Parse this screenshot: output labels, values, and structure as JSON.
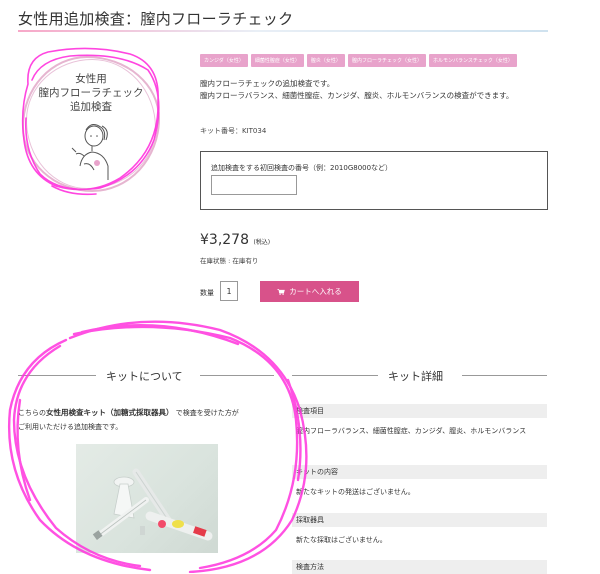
{
  "page": {
    "title": "女性用追加検査：膣内フローラチェック"
  },
  "product_image": {
    "lines": [
      "女性用",
      "膣内フローラチェック",
      "追加検査"
    ]
  },
  "tags": [
    "カンジダ（女性）",
    "細菌性膣症（女性）",
    "膣炎（女性）",
    "膣内フローラチェック（女性）",
    "ホルモンバランスチェック（女性）"
  ],
  "description": {
    "line1": "膣内フローラチェックの追加検査です。",
    "line2": "膣内フローラバランス、細菌性膣症、カンジダ、膣炎、ホルモンバランスの検査ができます。"
  },
  "kit_number": "キット番号：KIT034",
  "initial_test": {
    "label": "追加検査をする初回検査の番号（例：2010G8000など）",
    "value": ""
  },
  "price": {
    "amount": "¥3,278",
    "tax": "(税込)"
  },
  "stock": "在庫状態 : 在庫有り",
  "quantity": {
    "label": "数量",
    "value": "1"
  },
  "cart_button": "カートへ入れる",
  "kit_about": {
    "heading": "キットについて",
    "text_pre": "こちらの",
    "text_bold": "女性用検査キット（加糖式採取器具）",
    "text_post": "で検査を受けた方が",
    "text_line2": "ご利用いただける追加検査です。"
  },
  "kit_details": {
    "heading": "キット詳細",
    "rows": [
      {
        "label": "検査項目",
        "value": "膣内フローラバランス、細菌性膣症、カンジダ、膣炎、ホルモンバランス"
      },
      {
        "label": "キットの内容",
        "value": "新たなキットの発送はございません。"
      },
      {
        "label": "採取器具",
        "value": "新たな採取はございません。"
      },
      {
        "label": "検査方法",
        "value": ""
      }
    ]
  },
  "colors": {
    "accent": "#d8528a",
    "tag_bg": "#e8a3cb",
    "annotation": "#ff33dd"
  }
}
